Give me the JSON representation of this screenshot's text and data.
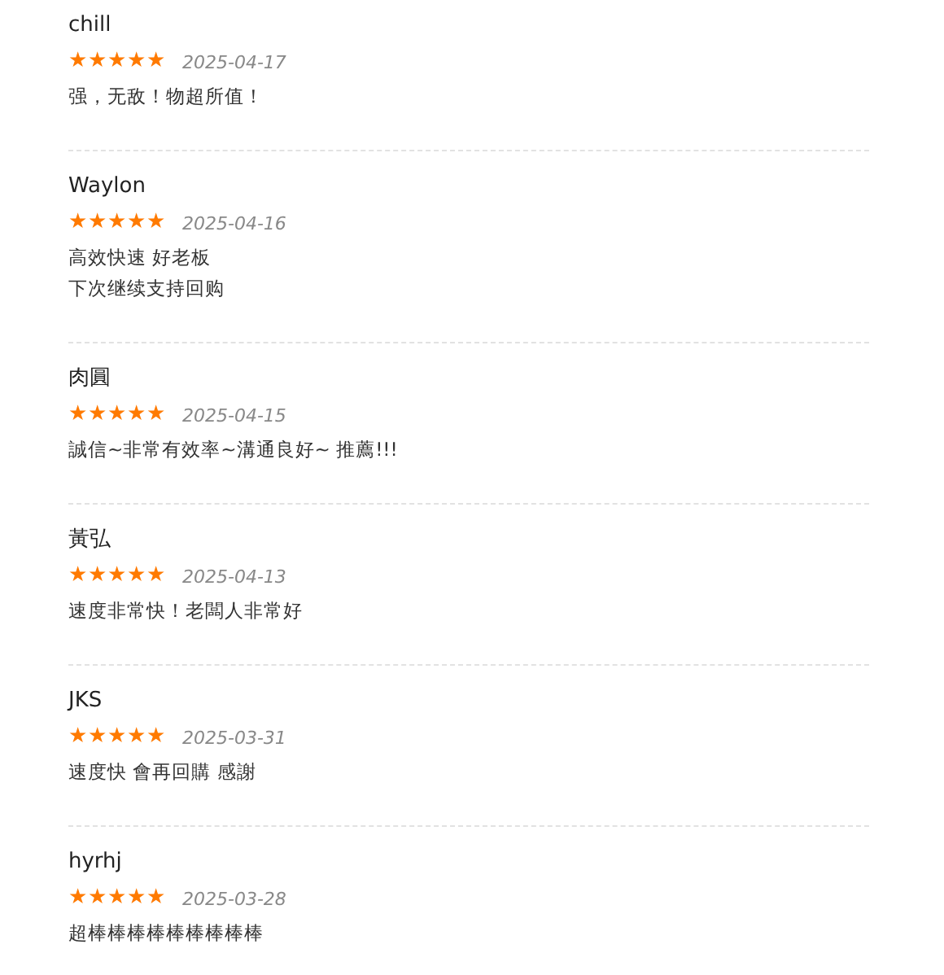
{
  "reviews": [
    {
      "name": "chill",
      "stars": 5,
      "date": "2025-04-17",
      "lines": [
        "强，无敌！物超所值！"
      ]
    },
    {
      "name": "Waylon",
      "stars": 5,
      "date": "2025-04-16",
      "lines": [
        "高效快速 好老板",
        "下次继续支持回购"
      ]
    },
    {
      "name": "肉圓",
      "stars": 5,
      "date": "2025-04-15",
      "lines": [
        "誠信~非常有效率~溝通良好~ 推薦!!!"
      ]
    },
    {
      "name": "黃弘",
      "stars": 5,
      "date": "2025-04-13",
      "lines": [
        "速度非常快！老闆人非常好"
      ]
    },
    {
      "name": "JKS",
      "stars": 5,
      "date": "2025-03-31",
      "lines": [
        "速度快 會再回購 感謝"
      ]
    },
    {
      "name": "hyrhj",
      "stars": 5,
      "date": "2025-03-28",
      "lines": [
        "超棒棒棒棒棒棒棒棒棒"
      ]
    }
  ]
}
